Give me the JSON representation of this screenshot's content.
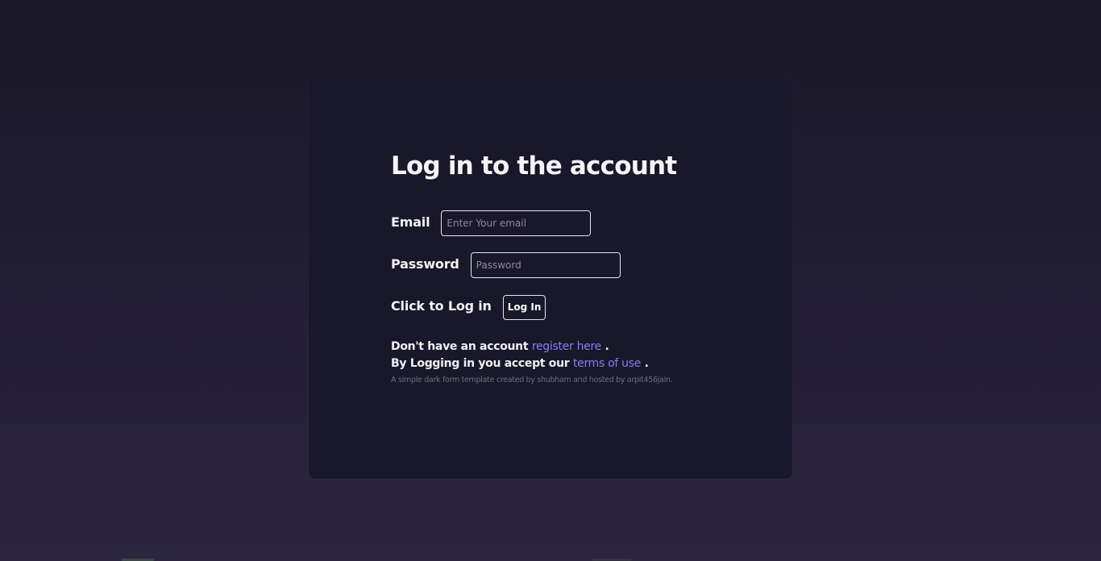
{
  "login": {
    "title": "Log in to the account",
    "email_label": "Email",
    "email_placeholder": "Enter Your email",
    "email_value": "",
    "password_label": "Password",
    "password_placeholder": "Password",
    "password_value": "",
    "login_prompt": "Click to Log in",
    "login_button": "Log In"
  },
  "footer": {
    "no_account_text": "Don't have an account ",
    "register_link": "register here",
    "period1": " .",
    "terms_text": "By Logging in you accept our ",
    "terms_link": "terms of use",
    "period2": " .",
    "credit": "A simple dark form template created by shubham and hosted by arpit456jain."
  },
  "colors": {
    "background": "#1a1826",
    "card": "#19172a",
    "link": "#8a7cf0",
    "muted_text": "#6f6c80"
  }
}
